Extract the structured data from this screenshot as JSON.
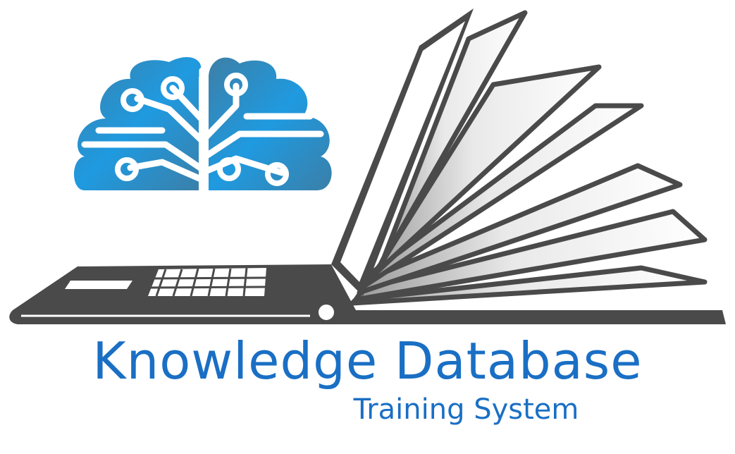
{
  "logo": {
    "title": "Knowledge Database",
    "subtitle": "Training System",
    "brain_icon": "brain-circuit-icon",
    "laptop_icon": "laptop-book-icon",
    "colors": {
      "brand_blue": "#1a6fc4",
      "brain_light": "#4fa8e6",
      "brain_dark": "#3b7fa8",
      "laptop_gray": "#4a4a4a"
    }
  }
}
